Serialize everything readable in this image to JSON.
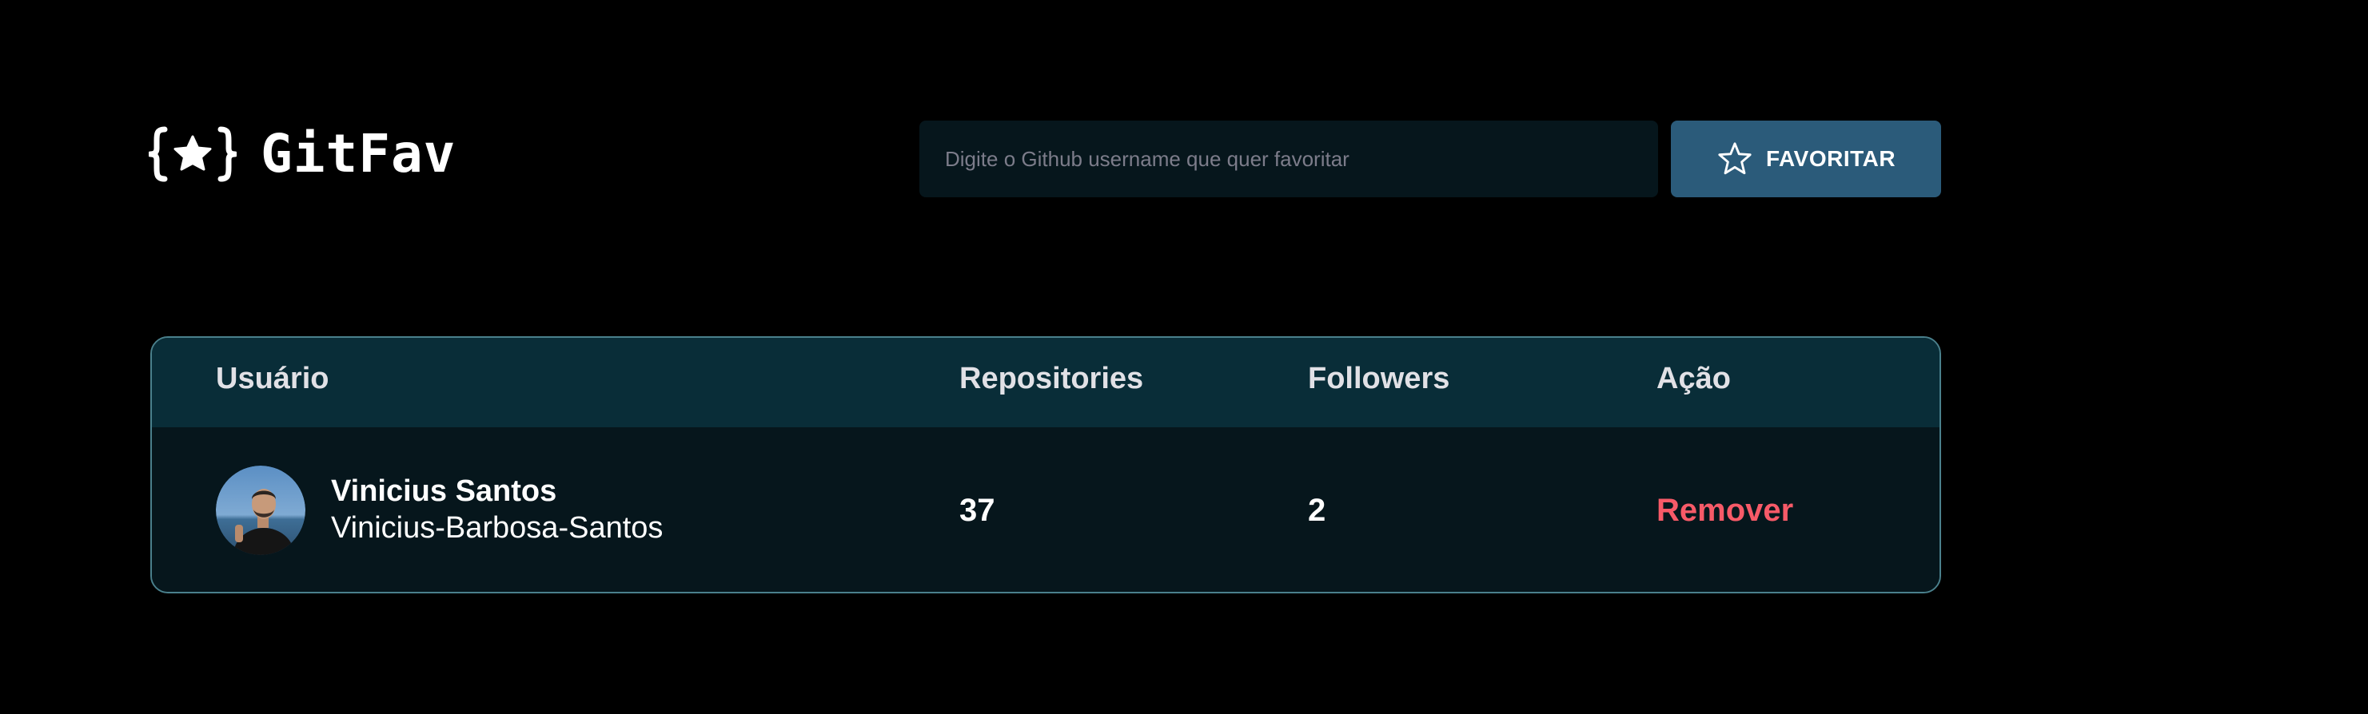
{
  "header": {
    "logo_text": "GitFav",
    "logo_icon": "braces-star-icon"
  },
  "search": {
    "placeholder": "Digite o Github username que quer favoritar",
    "value": ""
  },
  "favorite_button": {
    "label": "FAVORITAR",
    "icon": "star-icon"
  },
  "table": {
    "columns": [
      "Usuário",
      "Repositories",
      "Followers",
      "Ação"
    ],
    "rows": [
      {
        "name": "Vinicius Santos",
        "login": "Vinicius-Barbosa-Santos",
        "repositories": "37",
        "followers": "2",
        "action": "Remover"
      }
    ]
  },
  "colors": {
    "background": "#000000",
    "input_bg": "#06161C",
    "button_bg": "#2B5B7A",
    "table_head_bg": "#092D38",
    "table_row_bg": "#06161C",
    "table_border": "#4A808C",
    "remove": "#F75A68",
    "text": "#E1E1E6"
  }
}
